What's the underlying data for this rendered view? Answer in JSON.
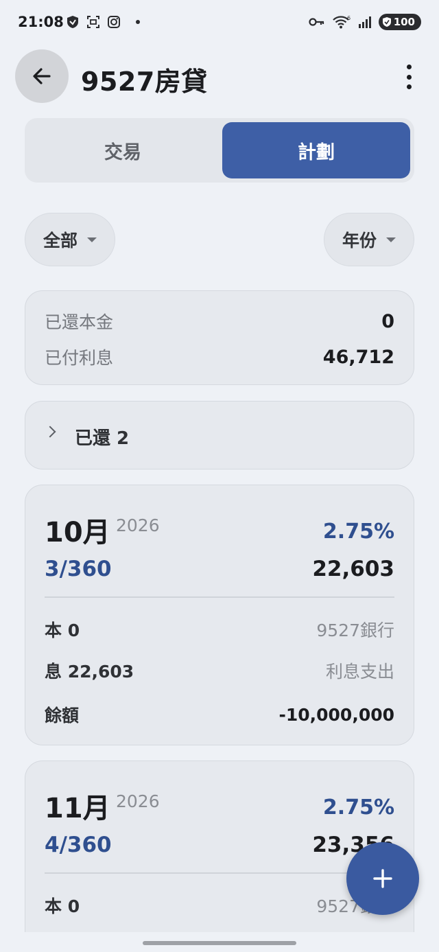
{
  "status_bar": {
    "time": "21:08",
    "battery": "100",
    "icons": [
      "shield-icon",
      "scan-icon",
      "instagram-icon",
      "dot-icon",
      "key-icon",
      "wifi-icon",
      "signal-icon"
    ],
    "wifi_badge": "6"
  },
  "app_bar": {
    "title": "9527房貸",
    "back_icon": "arrow-left-icon",
    "more_icon": "more-vert-icon"
  },
  "tabs": [
    {
      "label": "交易",
      "active": false
    },
    {
      "label": "計劃",
      "active": true
    }
  ],
  "filters": {
    "category": "全部",
    "period": "年份"
  },
  "summary": {
    "principal_label": "已還本金",
    "principal_value": "0",
    "interest_label": "已付利息",
    "interest_value": "46,712"
  },
  "repaid_section": {
    "label": "已還 2"
  },
  "schedule": [
    {
      "month": "10月",
      "year": "2026",
      "rate": "2.75%",
      "progress": "3/360",
      "amount": "22,603",
      "principal": "本 0",
      "account": "9527銀行",
      "interest": "息 22,603",
      "category": "利息支出",
      "balance_label": "餘額",
      "balance": "-10,000,000"
    },
    {
      "month": "11月",
      "year": "2026",
      "rate": "2.75%",
      "progress": "4/360",
      "amount": "23,356",
      "principal": "本 0",
      "account": "9527銀行"
    }
  ],
  "fab": {
    "icon": "plus-icon"
  },
  "colors": {
    "accent": "#3e5fa6",
    "accent_text": "#2f4f8f",
    "background": "#eef1f6",
    "card": "#e6e9ee"
  }
}
